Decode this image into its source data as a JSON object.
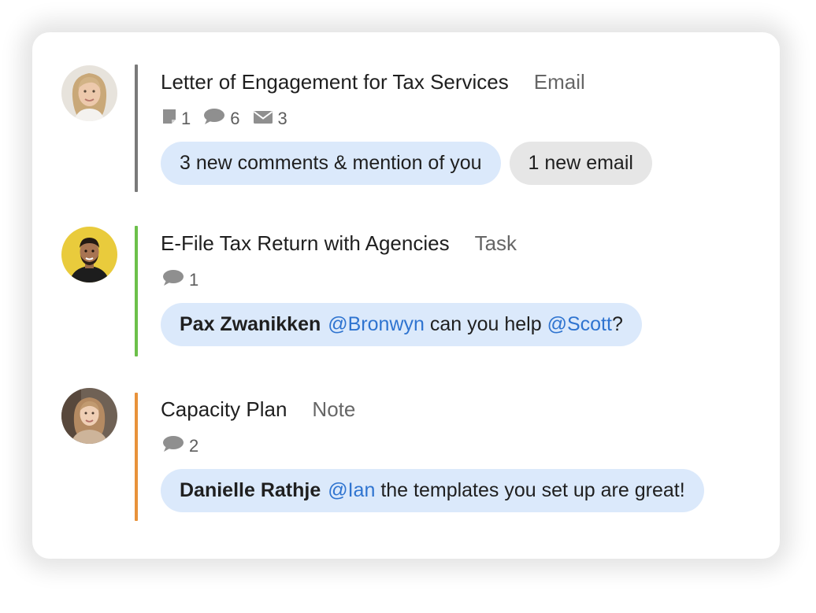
{
  "feed": {
    "items": [
      {
        "title": "Letter of Engagement for Tax Services",
        "type": "Email",
        "accent_color": "#7a7a7a",
        "counts": {
          "notes": "1",
          "comments": "6",
          "emails": "3"
        },
        "pills": {
          "comments_summary": "3 new comments & mention of you",
          "email_summary": "1 new email"
        }
      },
      {
        "title": "E-File Tax Return with Agencies",
        "type": "Task",
        "accent_color": "#6cc04a",
        "counts": {
          "comments": "1"
        },
        "comment": {
          "author": "Pax Zwanikken",
          "mention1": "@Bronwyn",
          "text1": " can you help ",
          "mention2": "@Scott",
          "text2": "?"
        }
      },
      {
        "title": "Capacity Plan",
        "type": "Note",
        "accent_color": "#e8923a",
        "counts": {
          "comments": "2"
        },
        "comment": {
          "author": "Danielle Rathje",
          "mention1": "@Ian",
          "text1": " the templates you set up are great!"
        }
      }
    ]
  }
}
